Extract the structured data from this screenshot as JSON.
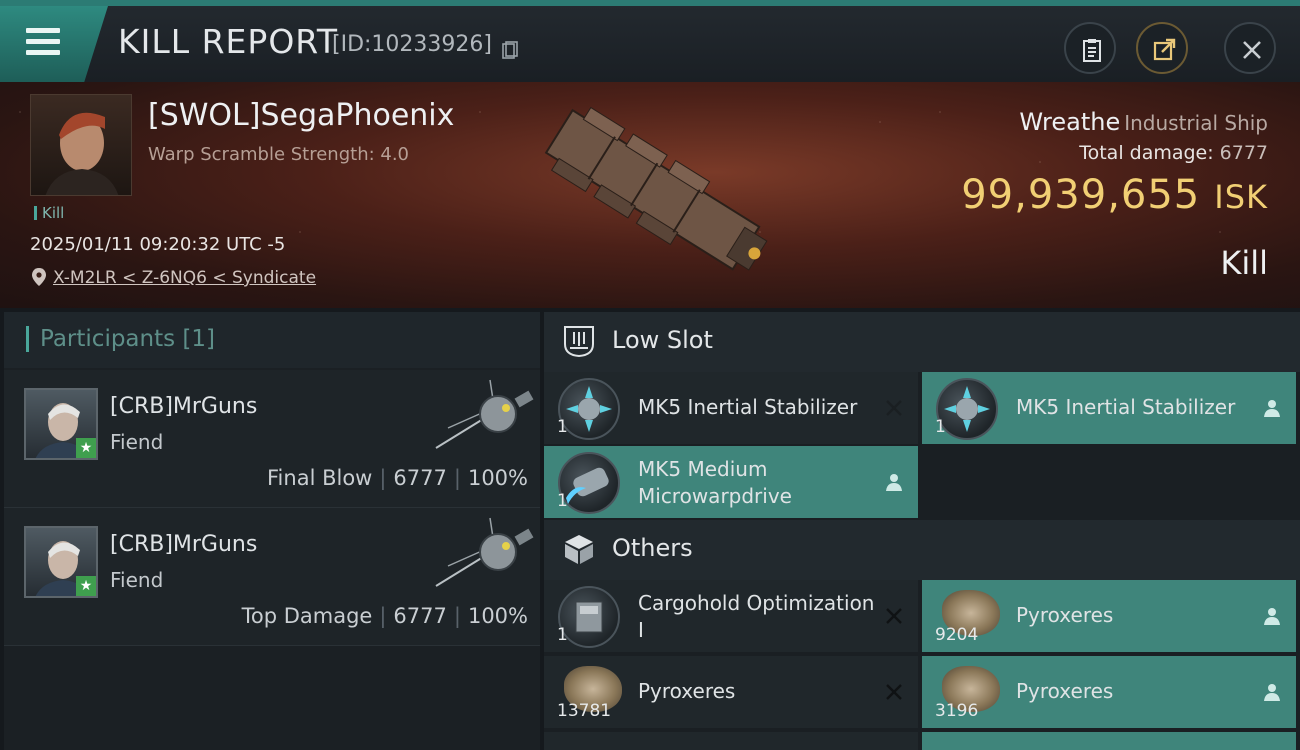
{
  "header": {
    "title": "KILL REPORT",
    "report_id": "[ID:10233926]",
    "icons": [
      "menu-icon",
      "copy-icon",
      "clipboard-icon",
      "share-icon",
      "close-icon"
    ]
  },
  "victim": {
    "name": "[SWOL]SegaPhoenix",
    "scramble": "Warp Scramble Strength: 4.0",
    "tag": "Kill",
    "timestamp": "2025/01/11 09:20:32 UTC -5",
    "location": "X-M2LR < Z-6NQ6 < Syndicate",
    "ship_name": "Wreathe",
    "ship_class": "Industrial Ship",
    "damage_label": "Total damage:",
    "damage_value": "6777",
    "isk_value": "99,939,655",
    "isk_unit": "ISK",
    "result": "Kill"
  },
  "participants": {
    "title": "Participants",
    "count": "[1]",
    "rows": [
      {
        "name": "[CRB]MrGuns",
        "ship": "Fiend",
        "role": "Final Blow",
        "damage": "6777",
        "percent": "100%"
      },
      {
        "name": "[CRB]MrGuns",
        "ship": "Fiend",
        "role": "Top Damage",
        "damage": "6777",
        "percent": "100%"
      }
    ]
  },
  "fitting": {
    "low_slot_title": "Low Slot",
    "others_title": "Others",
    "low_slots": [
      {
        "name": "MK5 Inertial Stabilizer",
        "qty": "1",
        "status": "destroyed"
      },
      {
        "name": "MK5 Inertial Stabilizer",
        "qty": "1",
        "status": "dropped"
      },
      {
        "name": "MK5 Medium Microwarpdrive",
        "qty": "1",
        "status": "dropped"
      }
    ],
    "others": [
      {
        "name": "Cargohold Optimization I",
        "qty": "1",
        "status": "destroyed"
      },
      {
        "name": "Pyroxeres",
        "qty": "9204",
        "status": "dropped"
      },
      {
        "name": "Pyroxeres",
        "qty": "13781",
        "status": "destroyed"
      },
      {
        "name": "Pyroxeres",
        "qty": "3196",
        "status": "dropped"
      }
    ]
  },
  "colors": {
    "accent": "#3f857b",
    "isk": "#f1cf74",
    "header_bar": "#2c7b74"
  }
}
